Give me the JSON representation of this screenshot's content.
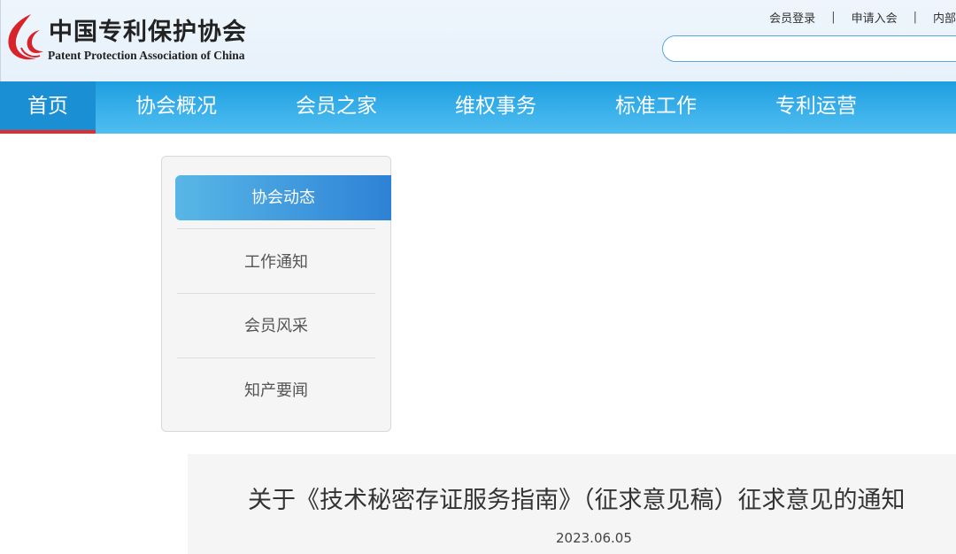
{
  "header": {
    "logo_cn": "中国专利保护协会",
    "logo_en": "Patent Protection Association of China",
    "top_links": [
      "会员登录",
      "申请入会",
      "内部"
    ],
    "separator": "|",
    "search": {
      "placeholder": ""
    }
  },
  "nav": {
    "items": [
      "首页",
      "协会概况",
      "会员之家",
      "维权事务",
      "标准工作",
      "专利运营"
    ],
    "active_index": 0,
    "colors": {
      "bar": "#3ab0ea",
      "active": "#1b8fd3",
      "underline": "#e02d2d"
    }
  },
  "sidebar": {
    "items": [
      "协会动态",
      "工作通知",
      "会员风采",
      "知产要闻"
    ],
    "active_index": 0
  },
  "article": {
    "title": "关于《技术秘密存证服务指南》（征求意见稿）征求意见的通知",
    "date": "2023.06.05"
  },
  "icons": {
    "logo": "ppac-logo-icon"
  }
}
